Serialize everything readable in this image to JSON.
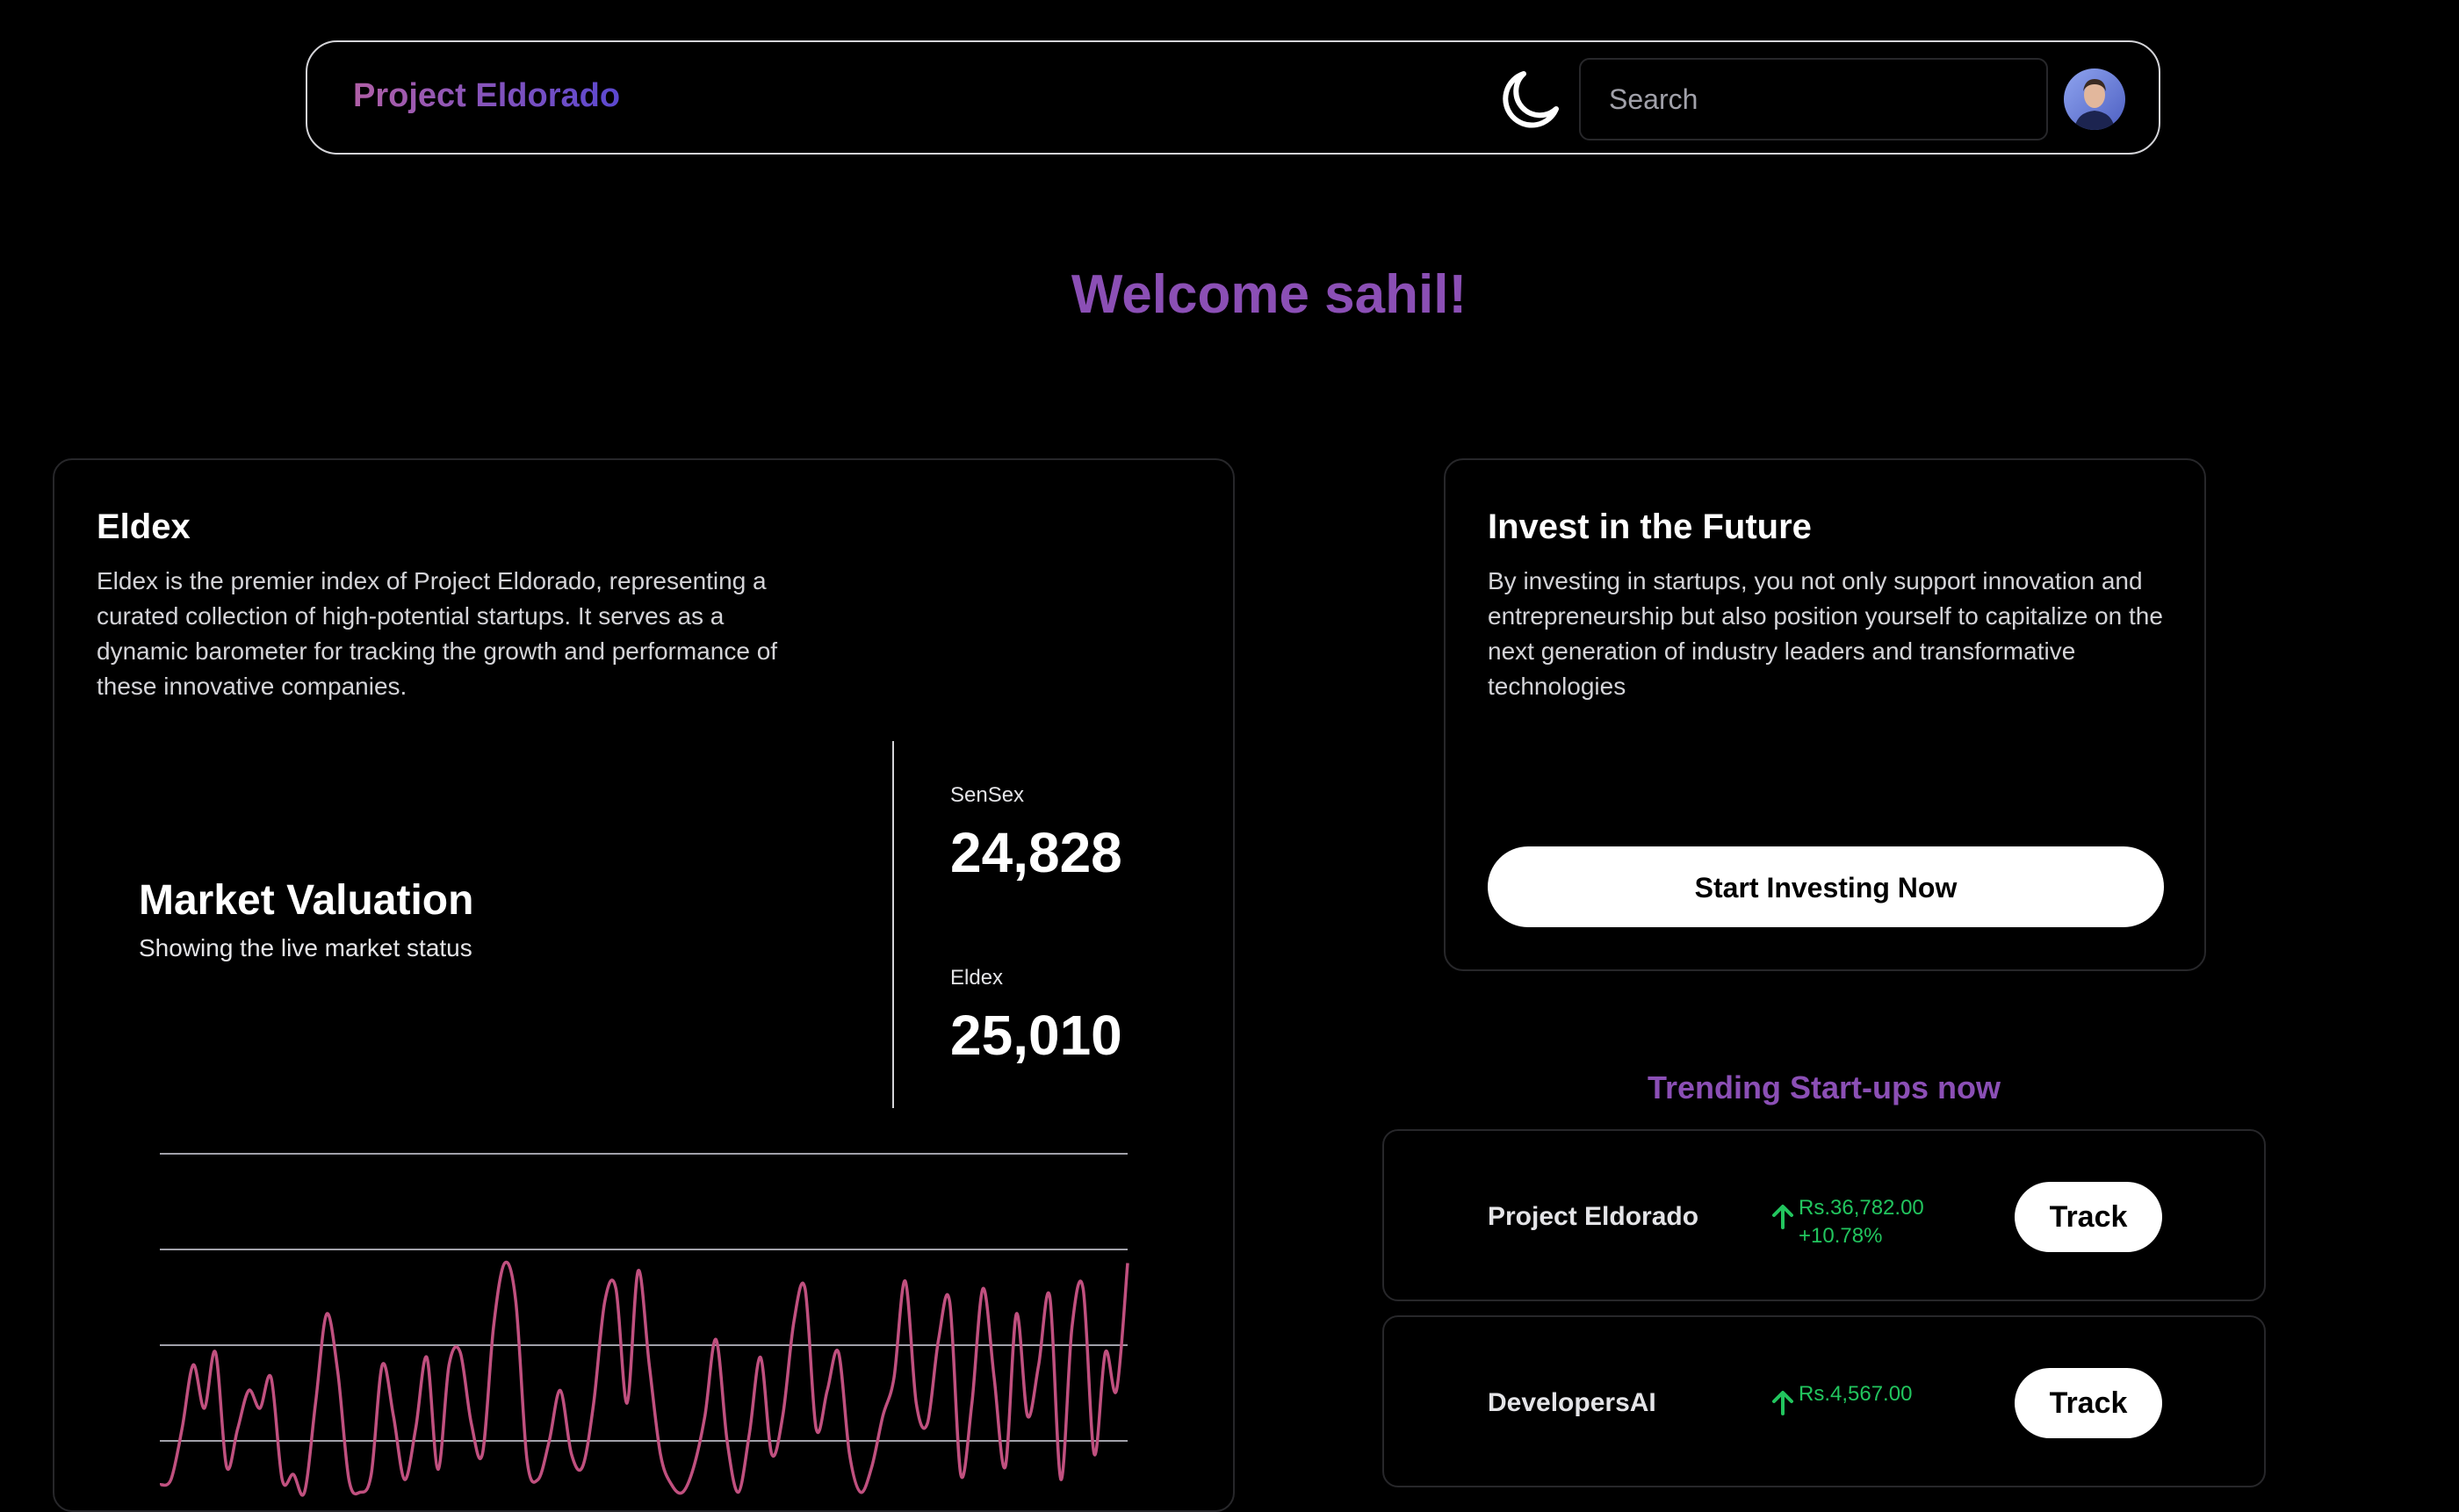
{
  "navbar": {
    "brand": "Project Eldorado",
    "theme_icon": "moon-icon",
    "search_placeholder": "Search",
    "avatar_icon": "user-avatar"
  },
  "welcome": "Welcome sahil!",
  "eldex_card": {
    "title": "Eldex",
    "description": "Eldex is the premier index of Project Eldorado, representing a curated collection of high-potential startups. It serves as a dynamic barometer for tracking the growth and performance of these innovative companies.",
    "market_valuation": {
      "title": "Market Valuation",
      "subtitle": "Showing the live market status"
    },
    "stats": [
      {
        "label": "SenSex",
        "value": "24,828"
      },
      {
        "label": "Eldex",
        "value": "25,010"
      }
    ]
  },
  "invest_card": {
    "title": "Invest in the Future",
    "description": "By investing in startups, you not only support innovation and entrepreneurship but also position yourself to capitalize on the next generation of industry leaders and transformative technologies",
    "button_label": "Start Investing Now"
  },
  "trending": {
    "title": "Trending Start-ups now",
    "items": [
      {
        "name": "Project Eldorado",
        "price": "Rs.36,782.00",
        "change": "+10.78%",
        "button_label": "Track"
      },
      {
        "name": "DevelopersAI",
        "price": "Rs.4,567.00",
        "change": "",
        "button_label": "Track"
      }
    ]
  },
  "chart_data": {
    "type": "line",
    "line_color": "#c0507f",
    "grid_color": "#a1a1aa",
    "grid": true,
    "values": [
      8,
      10,
      30,
      55,
      38,
      60,
      15,
      30,
      45,
      38,
      50,
      10,
      12,
      5,
      40,
      75,
      52,
      10,
      5,
      12,
      55,
      35,
      10,
      30,
      58,
      14,
      55,
      60,
      32,
      20,
      70,
      95,
      80,
      18,
      10,
      25,
      45,
      20,
      15,
      40,
      80,
      85,
      40,
      92,
      55,
      20,
      8,
      5,
      15,
      35,
      65,
      25,
      5,
      28,
      58,
      20,
      35,
      72,
      85,
      30,
      45,
      60,
      20,
      5,
      15,
      35,
      50,
      88,
      40,
      32,
      65,
      80,
      12,
      40,
      85,
      50,
      15,
      75,
      35,
      55,
      82,
      10,
      70,
      85,
      20,
      60,
      45,
      95
    ]
  }
}
